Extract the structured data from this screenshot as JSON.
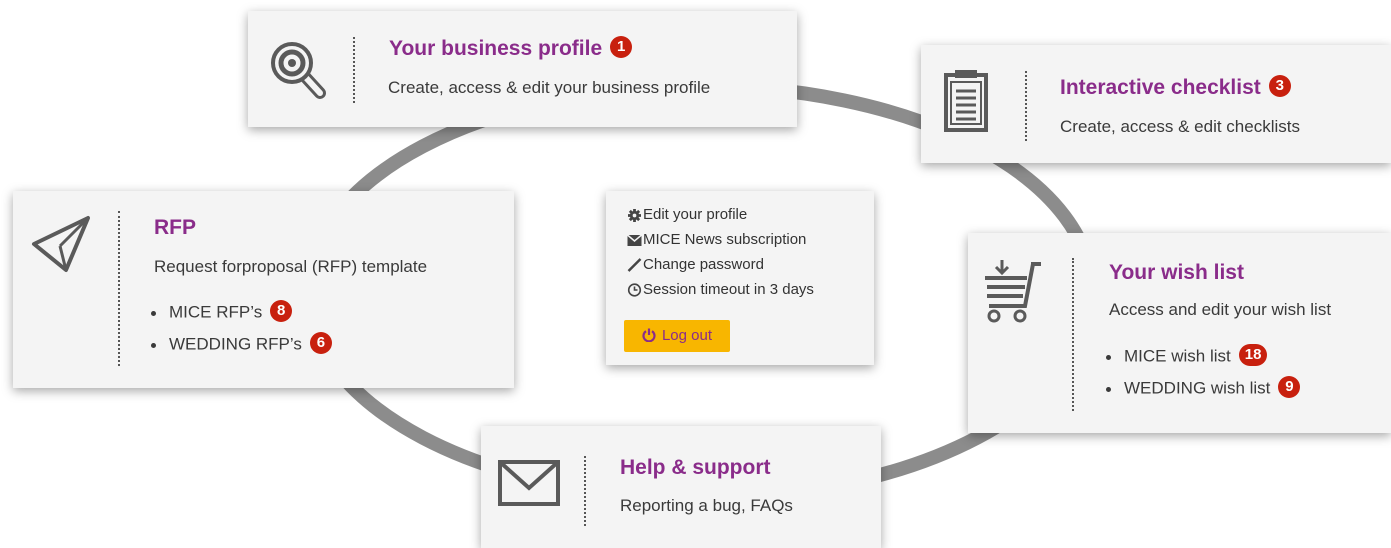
{
  "cards": {
    "business_profile": {
      "title": "Your business profile",
      "badge": "1",
      "description": "Create, access & edit your business profile",
      "icon": "magnifier-key-icon"
    },
    "checklist": {
      "title": "Interactive checklist",
      "badge": "3",
      "description": "Create, access & edit checklists",
      "icon": "clipboard-icon"
    },
    "rfp": {
      "title": "RFP",
      "description": "Request forproposal (RFP) template",
      "icon": "paper-plane-icon",
      "items": [
        {
          "label": "MICE RFP’s",
          "badge": "8"
        },
        {
          "label": "WEDDING RFP’s",
          "badge": "6"
        }
      ]
    },
    "wish_list": {
      "title": "Your wish list",
      "description": "Access and edit your wish list",
      "icon": "shopping-cart-icon",
      "items": [
        {
          "label": "MICE wish list",
          "badge": "18"
        },
        {
          "label": "WEDDING wish list",
          "badge": "9"
        }
      ]
    },
    "help": {
      "title": "Help & support",
      "description": "Reporting a bug, FAQs",
      "icon": "envelope-icon"
    }
  },
  "account_menu": {
    "items": [
      {
        "label": "Edit your profile",
        "icon": "gear-icon"
      },
      {
        "label": "MICE News subscription",
        "icon": "envelope-small-icon"
      },
      {
        "label": "Change password",
        "icon": "pencil-icon"
      },
      {
        "label": "Session timeout in 3 days",
        "icon": "clock-icon"
      }
    ],
    "logout_label": "Log out",
    "logout_icon": "power-icon"
  },
  "colors": {
    "title": "#8a2c8a",
    "badge": "#c8200e",
    "logout_bg": "#f8b600",
    "ring": "#8c8c8c",
    "card_bg": "#f4f4f4"
  }
}
